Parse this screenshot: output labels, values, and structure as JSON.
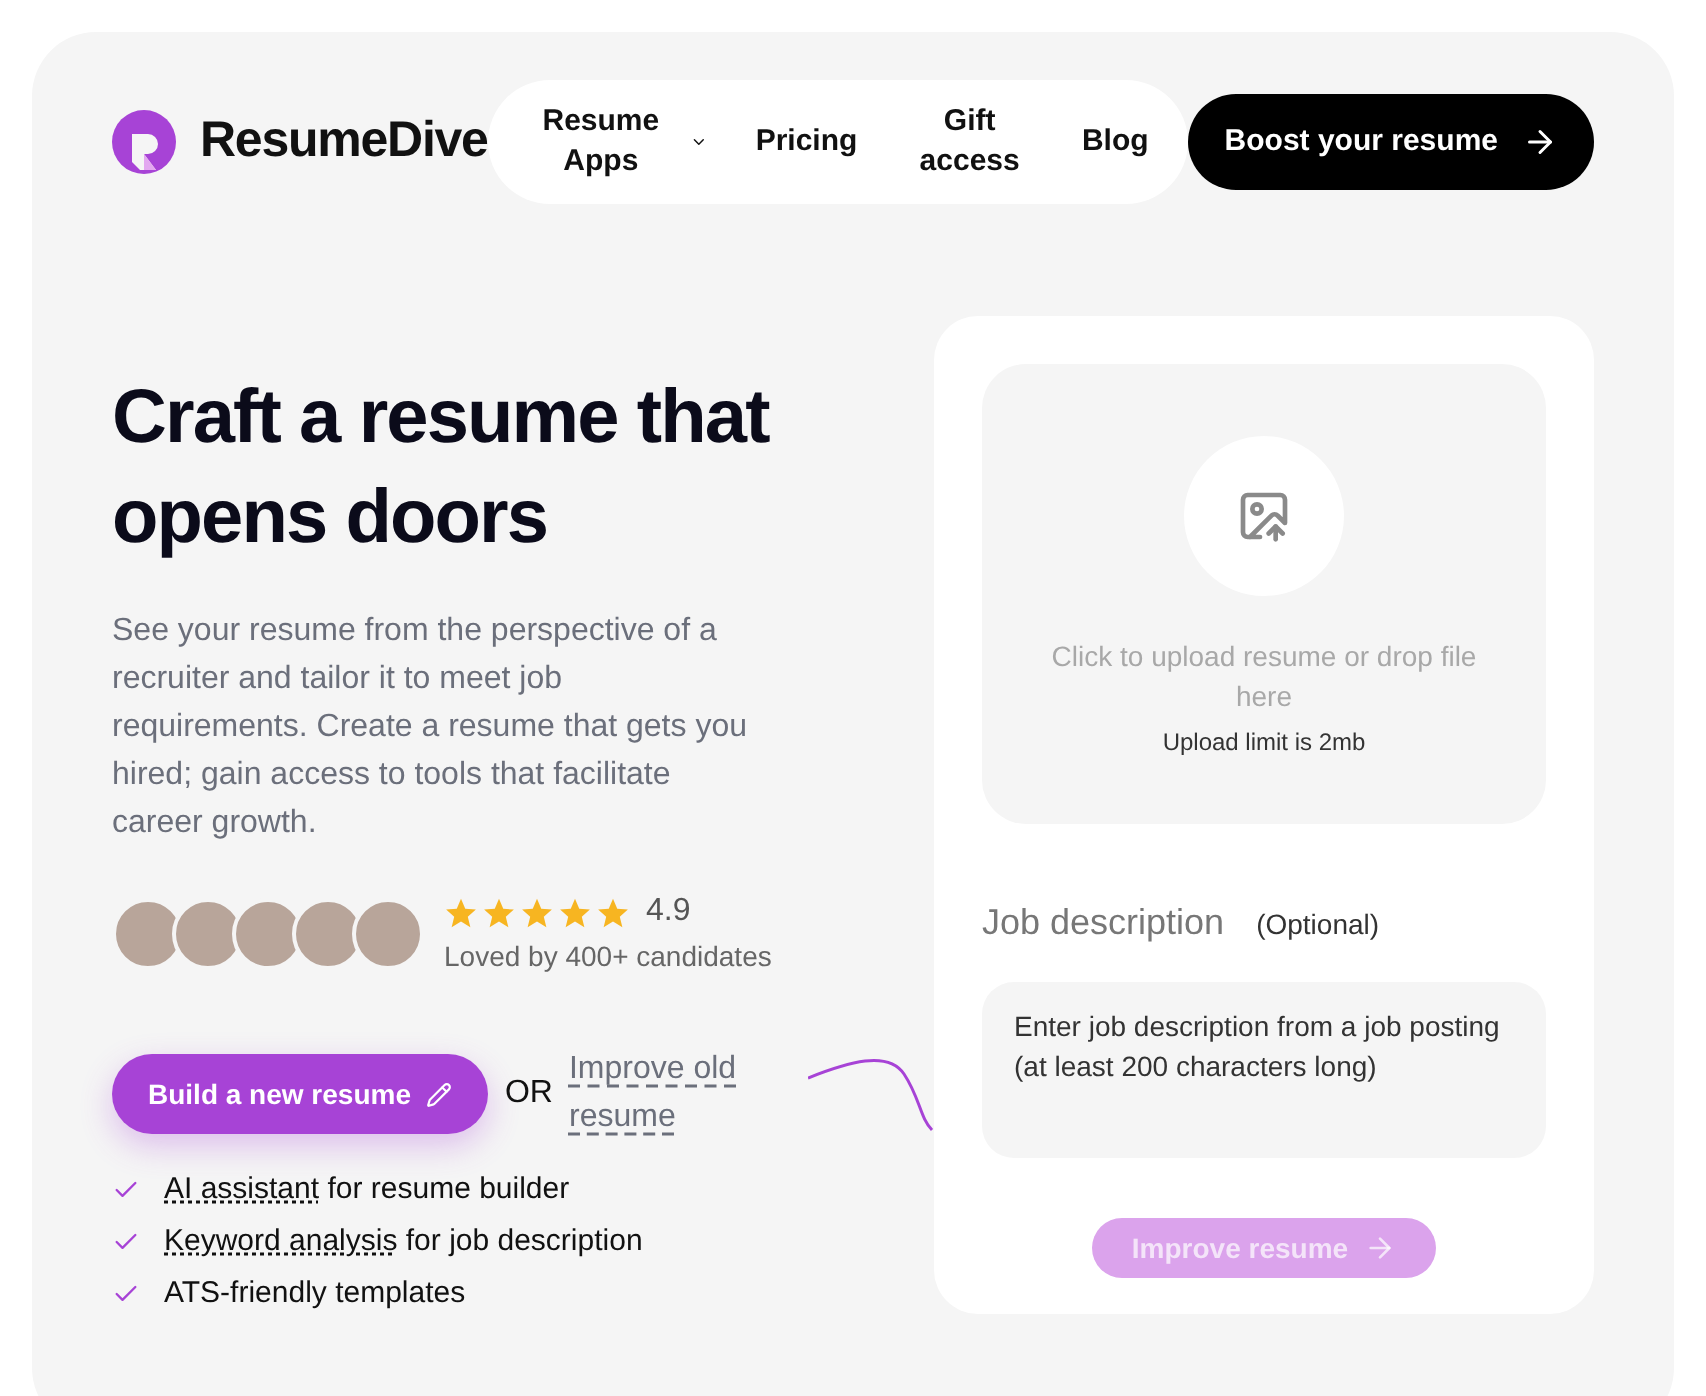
{
  "brand": {
    "name": "ResumeDive"
  },
  "nav": [
    {
      "label": "Resume Apps",
      "kind": "dropdown"
    },
    {
      "label": "Pricing",
      "kind": "link"
    },
    {
      "label": "Gift access",
      "kind": "link"
    },
    {
      "label": "Blog",
      "kind": "link"
    }
  ],
  "cta": {
    "label": "Boost your resume"
  },
  "hero": {
    "title": "Craft a resume that opens doors",
    "description": "See your resume from the perspective of a recruiter and tailor it to meet job requirements. Create a resume that gets you hired; gain access to tools that facilitate career growth."
  },
  "rating": {
    "stars": 5,
    "score": "4.9",
    "caption": "Loved by 400+ candidates"
  },
  "actions": {
    "primary": "Build a new resume",
    "separator": "OR",
    "secondary": "Improve old resume"
  },
  "features": [
    {
      "term": "AI assistant",
      "rest": "for resume builder"
    },
    {
      "term": "Keyword analysis",
      "rest": "for job description"
    },
    {
      "rest": "ATS-friendly templates"
    }
  ],
  "upload": {
    "prompt": "Click to upload resume or drop file here",
    "limit": "Upload limit is 2mb"
  },
  "job_description": {
    "label": "Job description",
    "note": "(Optional)",
    "placeholder": "Enter job description from a job posting (at least 200 characters long)"
  },
  "submit": {
    "label": "Improve resume",
    "disabled": true
  }
}
